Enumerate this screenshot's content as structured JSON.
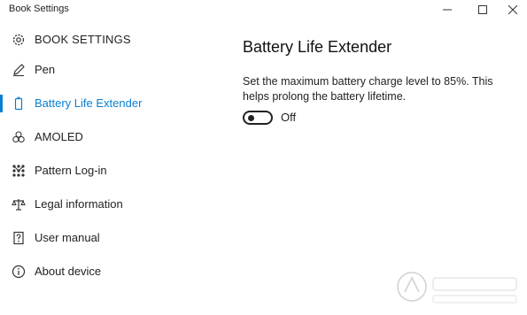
{
  "window": {
    "title": "Book Settings",
    "controls": [
      "minimize-icon",
      "maximize-icon",
      "close-icon"
    ]
  },
  "sidebar": {
    "header": {
      "label": "BOOK SETTINGS",
      "icon": "gear-icon"
    },
    "selected_index": 1,
    "accent_color": "#0a7fd1",
    "items": [
      {
        "label": "Pen",
        "icon": "pen-icon"
      },
      {
        "label": "Battery Life Extender",
        "icon": "battery-icon"
      },
      {
        "label": "AMOLED",
        "icon": "amoled-icon"
      },
      {
        "label": "Pattern Log-in",
        "icon": "pattern-icon"
      },
      {
        "label": "Legal information",
        "icon": "scales-icon"
      },
      {
        "label": "User manual",
        "icon": "manual-icon"
      },
      {
        "label": "About device",
        "icon": "info-icon"
      }
    ]
  },
  "main": {
    "title": "Battery Life Extender",
    "description": "Set the maximum battery charge level to 85%. This helps prolong the battery lifetime.",
    "toggle": {
      "on": false,
      "state_label": "Off"
    }
  }
}
